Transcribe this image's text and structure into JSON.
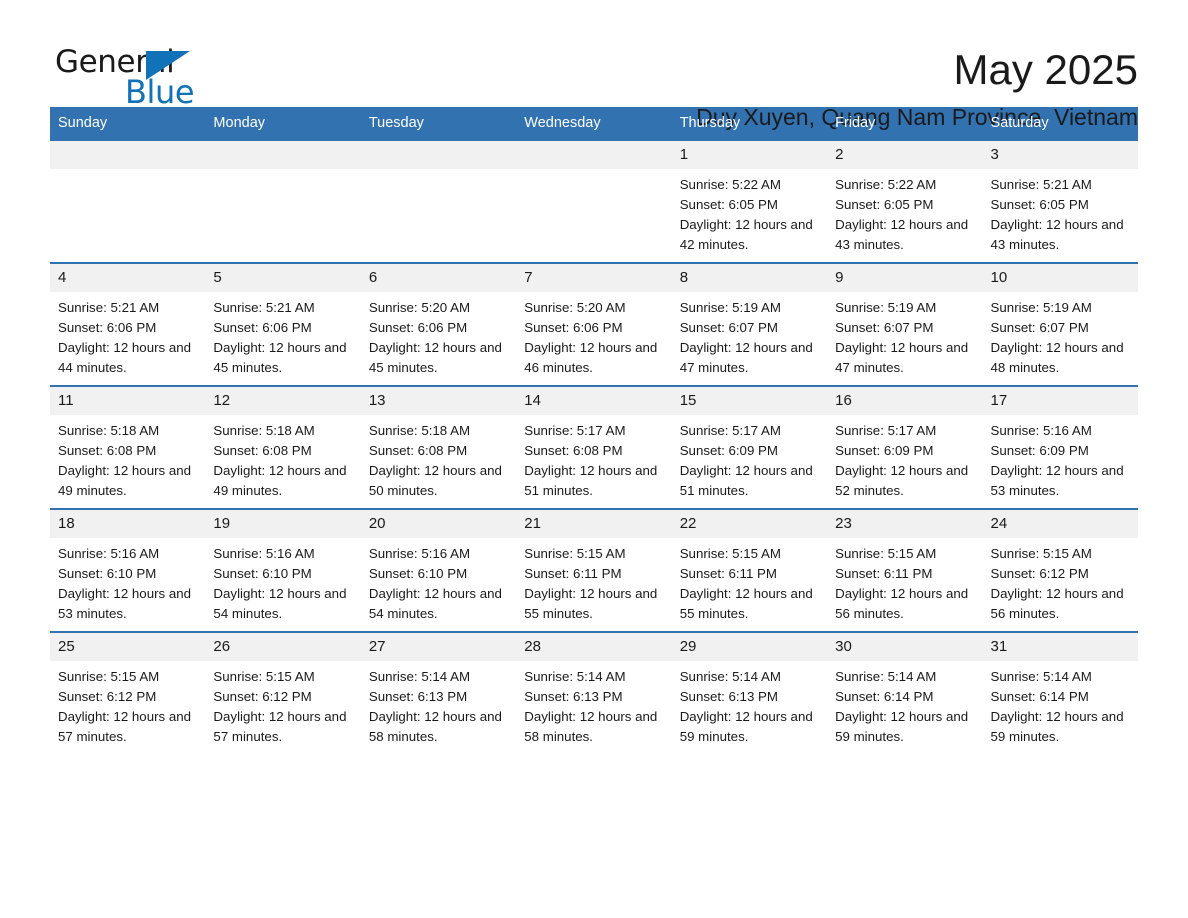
{
  "brand": {
    "logo_word_1": "General",
    "logo_word_2": "Blue",
    "logo_icon": "triangle-icon",
    "accent_color": "#1272b8"
  },
  "header": {
    "title": "May 2025",
    "location": "Duy Xuyen, Quang Nam Province, Vietnam"
  },
  "calendar": {
    "header_bg": "#3272b0",
    "daynum_bg": "#f1f1f1",
    "weekday_headers": [
      "Sunday",
      "Monday",
      "Tuesday",
      "Wednesday",
      "Thursday",
      "Friday",
      "Saturday"
    ],
    "weeks": [
      [
        {
          "day": "",
          "sunrise": "",
          "sunset": "",
          "daylight": ""
        },
        {
          "day": "",
          "sunrise": "",
          "sunset": "",
          "daylight": ""
        },
        {
          "day": "",
          "sunrise": "",
          "sunset": "",
          "daylight": ""
        },
        {
          "day": "",
          "sunrise": "",
          "sunset": "",
          "daylight": ""
        },
        {
          "day": "1",
          "sunrise": "Sunrise: 5:22 AM",
          "sunset": "Sunset: 6:05 PM",
          "daylight": "Daylight: 12 hours and 42 minutes."
        },
        {
          "day": "2",
          "sunrise": "Sunrise: 5:22 AM",
          "sunset": "Sunset: 6:05 PM",
          "daylight": "Daylight: 12 hours and 43 minutes."
        },
        {
          "day": "3",
          "sunrise": "Sunrise: 5:21 AM",
          "sunset": "Sunset: 6:05 PM",
          "daylight": "Daylight: 12 hours and 43 minutes."
        }
      ],
      [
        {
          "day": "4",
          "sunrise": "Sunrise: 5:21 AM",
          "sunset": "Sunset: 6:06 PM",
          "daylight": "Daylight: 12 hours and 44 minutes."
        },
        {
          "day": "5",
          "sunrise": "Sunrise: 5:21 AM",
          "sunset": "Sunset: 6:06 PM",
          "daylight": "Daylight: 12 hours and 45 minutes."
        },
        {
          "day": "6",
          "sunrise": "Sunrise: 5:20 AM",
          "sunset": "Sunset: 6:06 PM",
          "daylight": "Daylight: 12 hours and 45 minutes."
        },
        {
          "day": "7",
          "sunrise": "Sunrise: 5:20 AM",
          "sunset": "Sunset: 6:06 PM",
          "daylight": "Daylight: 12 hours and 46 minutes."
        },
        {
          "day": "8",
          "sunrise": "Sunrise: 5:19 AM",
          "sunset": "Sunset: 6:07 PM",
          "daylight": "Daylight: 12 hours and 47 minutes."
        },
        {
          "day": "9",
          "sunrise": "Sunrise: 5:19 AM",
          "sunset": "Sunset: 6:07 PM",
          "daylight": "Daylight: 12 hours and 47 minutes."
        },
        {
          "day": "10",
          "sunrise": "Sunrise: 5:19 AM",
          "sunset": "Sunset: 6:07 PM",
          "daylight": "Daylight: 12 hours and 48 minutes."
        }
      ],
      [
        {
          "day": "11",
          "sunrise": "Sunrise: 5:18 AM",
          "sunset": "Sunset: 6:08 PM",
          "daylight": "Daylight: 12 hours and 49 minutes."
        },
        {
          "day": "12",
          "sunrise": "Sunrise: 5:18 AM",
          "sunset": "Sunset: 6:08 PM",
          "daylight": "Daylight: 12 hours and 49 minutes."
        },
        {
          "day": "13",
          "sunrise": "Sunrise: 5:18 AM",
          "sunset": "Sunset: 6:08 PM",
          "daylight": "Daylight: 12 hours and 50 minutes."
        },
        {
          "day": "14",
          "sunrise": "Sunrise: 5:17 AM",
          "sunset": "Sunset: 6:08 PM",
          "daylight": "Daylight: 12 hours and 51 minutes."
        },
        {
          "day": "15",
          "sunrise": "Sunrise: 5:17 AM",
          "sunset": "Sunset: 6:09 PM",
          "daylight": "Daylight: 12 hours and 51 minutes."
        },
        {
          "day": "16",
          "sunrise": "Sunrise: 5:17 AM",
          "sunset": "Sunset: 6:09 PM",
          "daylight": "Daylight: 12 hours and 52 minutes."
        },
        {
          "day": "17",
          "sunrise": "Sunrise: 5:16 AM",
          "sunset": "Sunset: 6:09 PM",
          "daylight": "Daylight: 12 hours and 53 minutes."
        }
      ],
      [
        {
          "day": "18",
          "sunrise": "Sunrise: 5:16 AM",
          "sunset": "Sunset: 6:10 PM",
          "daylight": "Daylight: 12 hours and 53 minutes."
        },
        {
          "day": "19",
          "sunrise": "Sunrise: 5:16 AM",
          "sunset": "Sunset: 6:10 PM",
          "daylight": "Daylight: 12 hours and 54 minutes."
        },
        {
          "day": "20",
          "sunrise": "Sunrise: 5:16 AM",
          "sunset": "Sunset: 6:10 PM",
          "daylight": "Daylight: 12 hours and 54 minutes."
        },
        {
          "day": "21",
          "sunrise": "Sunrise: 5:15 AM",
          "sunset": "Sunset: 6:11 PM",
          "daylight": "Daylight: 12 hours and 55 minutes."
        },
        {
          "day": "22",
          "sunrise": "Sunrise: 5:15 AM",
          "sunset": "Sunset: 6:11 PM",
          "daylight": "Daylight: 12 hours and 55 minutes."
        },
        {
          "day": "23",
          "sunrise": "Sunrise: 5:15 AM",
          "sunset": "Sunset: 6:11 PM",
          "daylight": "Daylight: 12 hours and 56 minutes."
        },
        {
          "day": "24",
          "sunrise": "Sunrise: 5:15 AM",
          "sunset": "Sunset: 6:12 PM",
          "daylight": "Daylight: 12 hours and 56 minutes."
        }
      ],
      [
        {
          "day": "25",
          "sunrise": "Sunrise: 5:15 AM",
          "sunset": "Sunset: 6:12 PM",
          "daylight": "Daylight: 12 hours and 57 minutes."
        },
        {
          "day": "26",
          "sunrise": "Sunrise: 5:15 AM",
          "sunset": "Sunset: 6:12 PM",
          "daylight": "Daylight: 12 hours and 57 minutes."
        },
        {
          "day": "27",
          "sunrise": "Sunrise: 5:14 AM",
          "sunset": "Sunset: 6:13 PM",
          "daylight": "Daylight: 12 hours and 58 minutes."
        },
        {
          "day": "28",
          "sunrise": "Sunrise: 5:14 AM",
          "sunset": "Sunset: 6:13 PM",
          "daylight": "Daylight: 12 hours and 58 minutes."
        },
        {
          "day": "29",
          "sunrise": "Sunrise: 5:14 AM",
          "sunset": "Sunset: 6:13 PM",
          "daylight": "Daylight: 12 hours and 59 minutes."
        },
        {
          "day": "30",
          "sunrise": "Sunrise: 5:14 AM",
          "sunset": "Sunset: 6:14 PM",
          "daylight": "Daylight: 12 hours and 59 minutes."
        },
        {
          "day": "31",
          "sunrise": "Sunrise: 5:14 AM",
          "sunset": "Sunset: 6:14 PM",
          "daylight": "Daylight: 12 hours and 59 minutes."
        }
      ]
    ]
  }
}
